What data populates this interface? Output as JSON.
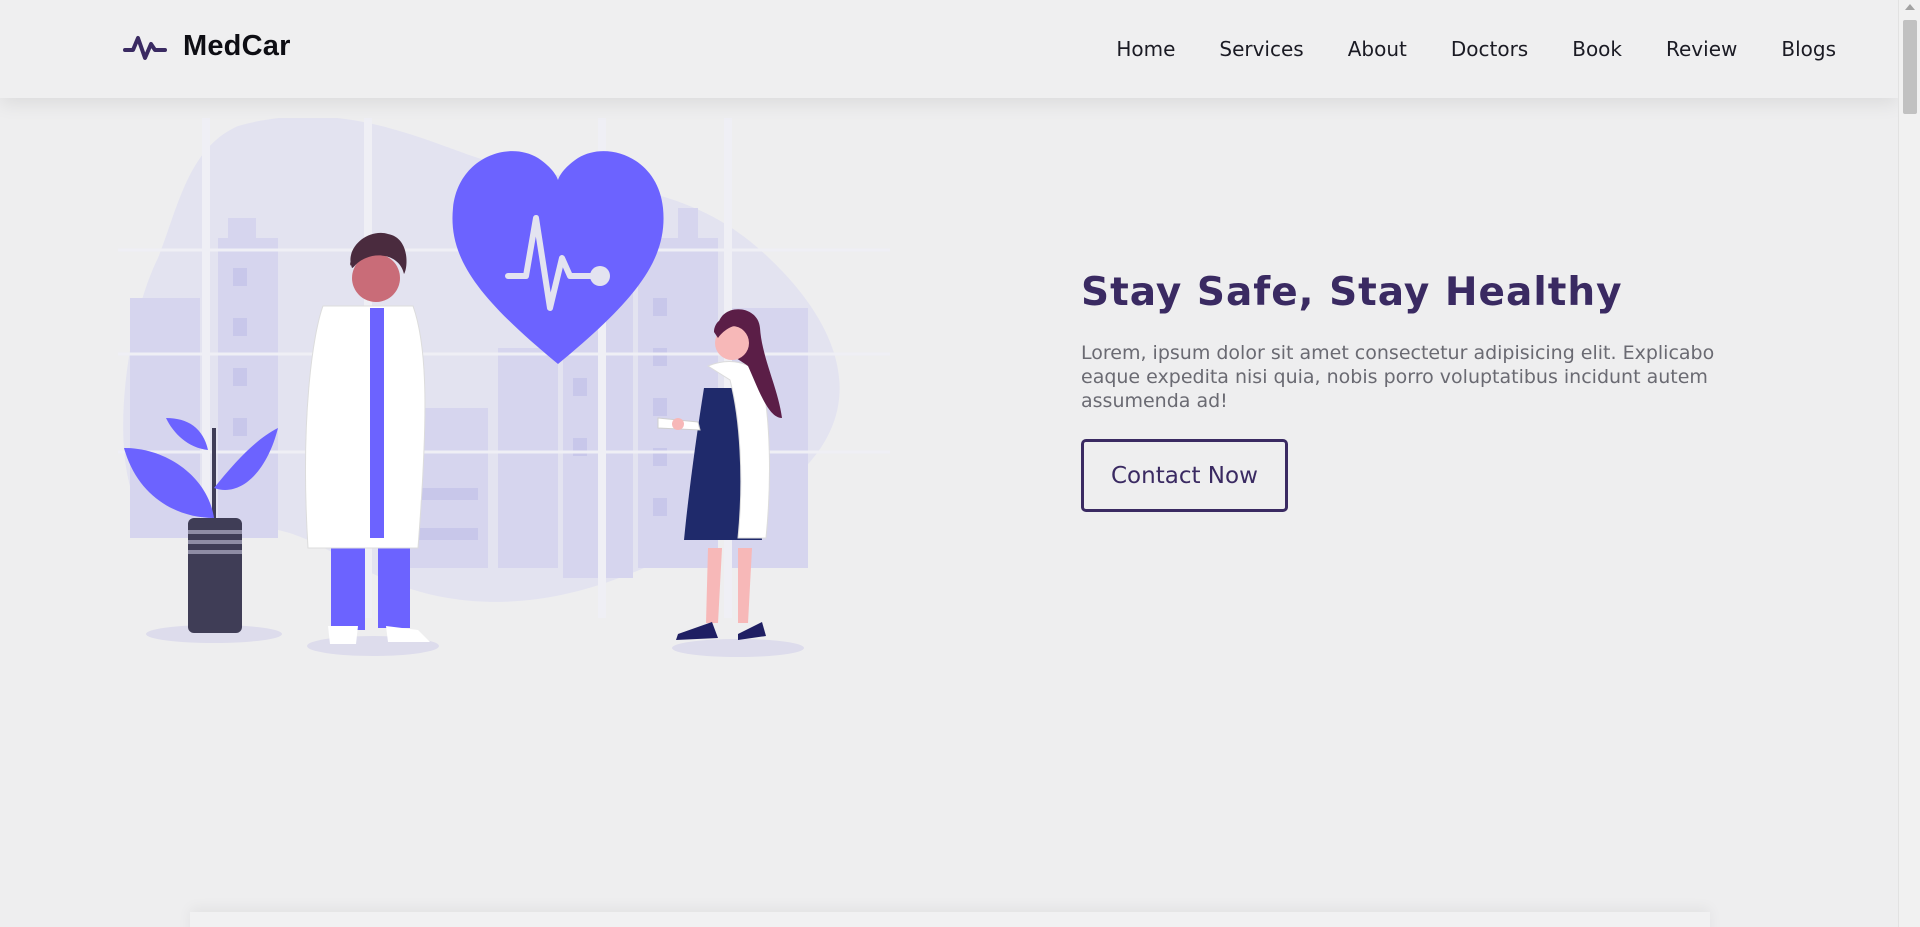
{
  "header": {
    "brand": "MedCar",
    "logo_icon": "heartbeat-icon",
    "nav": [
      {
        "label": "Home"
      },
      {
        "label": "Services"
      },
      {
        "label": "About"
      },
      {
        "label": "Doctors"
      },
      {
        "label": "Book"
      },
      {
        "label": "Review"
      },
      {
        "label": "Blogs"
      }
    ]
  },
  "hero": {
    "title": "Stay Safe, Stay Healthy",
    "description": "Lorem, ipsum dolor sit amet consectetur adipisicing elit. Explicabo eaque expedita nisi quia, nobis porro voluptatibus incidunt autem assumenda ad!",
    "cta_label": "Contact Now",
    "illustration": "doctors-heart-illustration"
  },
  "colors": {
    "accent": "#6c63ff",
    "brand_dark": "#3a2a62",
    "background": "#eeeeef"
  }
}
